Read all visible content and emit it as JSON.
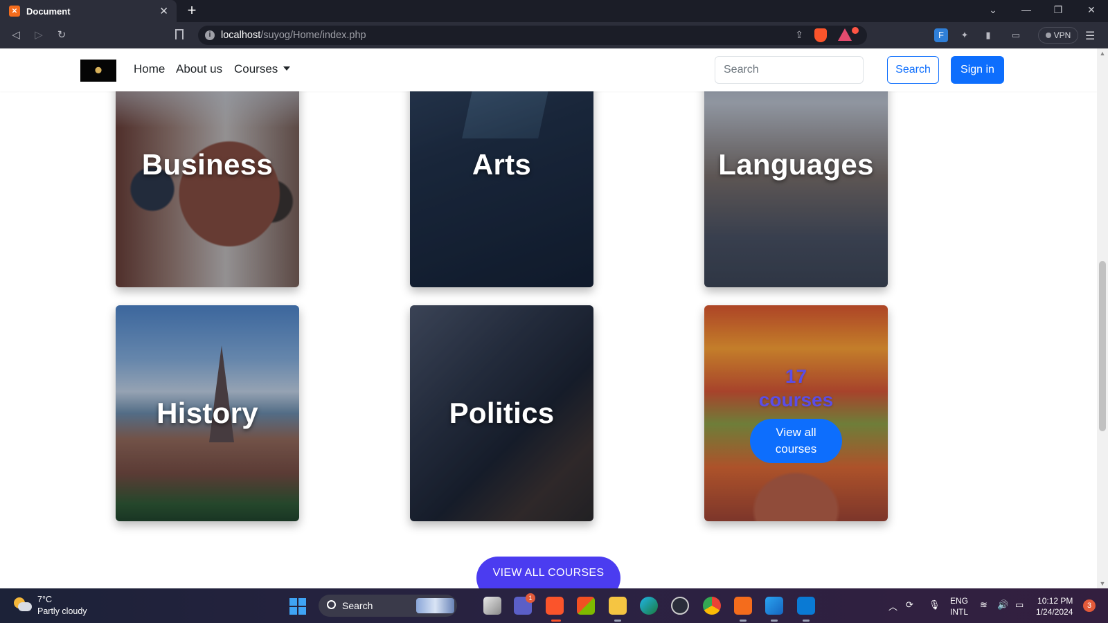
{
  "browser": {
    "tab_title": "Document",
    "tab_favicon": "xampp-icon",
    "url_host": "localhost",
    "url_path": "/suyog/Home/index.php",
    "vpn_label": "VPN"
  },
  "navbar": {
    "home": "Home",
    "about": "About us",
    "courses": "Courses",
    "search_placeholder": "Search",
    "search_button": "Search",
    "signin_button": "Sign in"
  },
  "cards": [
    {
      "title": "Business"
    },
    {
      "title": "Arts"
    },
    {
      "title": "Languages"
    },
    {
      "title": "History"
    },
    {
      "title": "Politics"
    }
  ],
  "all_courses_card": {
    "count": "17",
    "count_label": "courses",
    "button_line1": "View all",
    "button_line2": "courses"
  },
  "view_all_button": "VIEW ALL COURSES",
  "taskbar": {
    "weather_temp": "7°C",
    "weather_desc": "Partly cloudy",
    "search_label": "Search",
    "chat_badge": "1",
    "lang_line1": "ENG",
    "lang_line2": "INTL",
    "time": "10:12 PM",
    "date": "1/24/2024",
    "notification_count": "3"
  },
  "colors": {
    "primary": "#0d6efd",
    "view_all_purple": "#4b3cf0",
    "courses_count": "#5b4de6"
  }
}
